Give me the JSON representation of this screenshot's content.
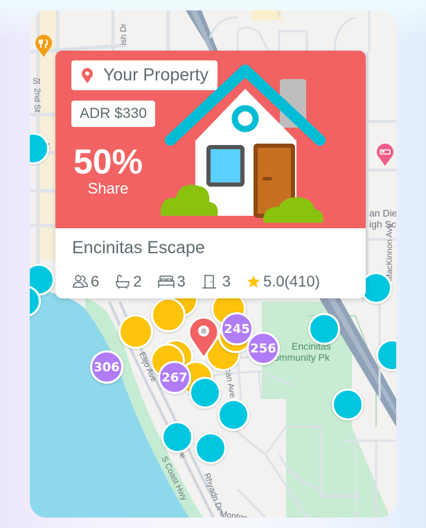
{
  "property_card": {
    "tag_label": "Your Property",
    "adr_label": "ADR $330",
    "share_value": "50%",
    "share_label": "Share",
    "name": "Encinitas Escape",
    "stats": {
      "guests": "6",
      "bathrooms": "2",
      "beds": "3",
      "bedrooms": "3",
      "rating": "5.0",
      "review_count": "(410)"
    },
    "hero_color": "#f26262"
  },
  "map": {
    "street_labels": [
      "ish Dr",
      "St",
      "2nd St",
      "St",
      "Elijo Ave",
      "Elijo Ave",
      "S Coast Hwy",
      "Rhyadn Dr",
      "Montgo",
      "MacKinnon Ave",
      "Vulcan Ave",
      "an Die",
      "igh Sc"
    ],
    "park_label": [
      "Encinitas",
      "Community Pk"
    ],
    "clusters": [
      {
        "label": "306",
        "color": "#b07cf8"
      },
      {
        "label": "267",
        "color": "#b07cf8"
      },
      {
        "label": "245",
        "color": "#b07cf8"
      },
      {
        "label": "256",
        "color": "#b07cf8"
      }
    ],
    "marker_colors": {
      "cyan": "#00c6e0",
      "yellow": "#fec40b",
      "purple": "#b07cf8",
      "pin": "#f26262"
    },
    "poi": [
      "restaurant",
      "hotel"
    ]
  }
}
